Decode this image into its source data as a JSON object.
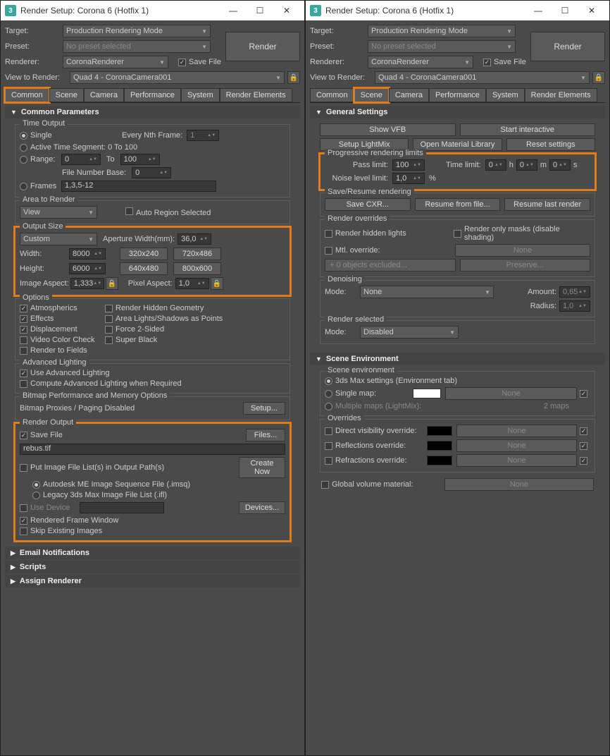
{
  "left": {
    "title": "Render Setup: Corona 6 (Hotfix 1)",
    "target_lbl": "Target:",
    "target": "Production Rendering Mode",
    "preset_lbl": "Preset:",
    "preset": "No preset selected",
    "renderer_lbl": "Renderer:",
    "renderer": "CoronaRenderer",
    "savefile": "Save File",
    "render_btn": "Render",
    "view_lbl": "View to Render:",
    "view": "Quad 4 - CoronaCamera001",
    "tabs": [
      "Common",
      "Scene",
      "Camera",
      "Performance",
      "System",
      "Render Elements"
    ],
    "rollup": "Common Parameters",
    "time": {
      "hdr": "Time Output",
      "single": "Single",
      "every": "Every Nth Frame:",
      "every_v": "1",
      "active": "Active Time Segment:",
      "active_v": "0 To 100",
      "range": "Range:",
      "r1": "0",
      "to": "To",
      "r2": "100",
      "fnb": "File Number Base:",
      "fnb_v": "0",
      "frames": "Frames",
      "frames_v": "1,3,5-12"
    },
    "area": {
      "hdr": "Area to Render",
      "view": "View",
      "auto": "Auto Region Selected"
    },
    "out": {
      "hdr": "Output Size",
      "custom": "Custom",
      "ap": "Aperture Width(mm):",
      "ap_v": "36,0",
      "w": "Width:",
      "w_v": "8000",
      "h": "Height:",
      "h_v": "6000",
      "p1": "320x240",
      "p2": "720x486",
      "p3": "640x480",
      "p4": "800x600",
      "ia": "Image Aspect:",
      "ia_v": "1,333",
      "pa": "Pixel Aspect:",
      "pa_v": "1,0"
    },
    "opt": {
      "hdr": "Options",
      "atm": "Atmospherics",
      "rhg": "Render Hidden Geometry",
      "eff": "Effects",
      "als": "Area Lights/Shadows as Points",
      "disp": "Displacement",
      "f2": "Force 2-Sided",
      "vcc": "Video Color Check",
      "sb": "Super Black",
      "rtf": "Render to Fields"
    },
    "adv": {
      "hdr": "Advanced Lighting",
      "use": "Use Advanced Lighting",
      "comp": "Compute Advanced Lighting when Required"
    },
    "bmp": {
      "hdr": "Bitmap Performance and Memory Options",
      "txt": "Bitmap Proxies / Paging Disabled",
      "setup": "Setup..."
    },
    "ro": {
      "hdr": "Render Output",
      "sf": "Save File",
      "files": "Files...",
      "file": "rebus.tif",
      "put": "Put Image File List(s) in Output Path(s)",
      "create": "Create Now",
      "ame": "Autodesk ME Image Sequence File (.imsq)",
      "leg": "Legacy 3ds Max Image File List (.ifl)",
      "ud": "Use Device",
      "dev": "Devices...",
      "rfw": "Rendered Frame Window",
      "skip": "Skip Existing Images"
    },
    "more": [
      "Email Notifications",
      "Scripts",
      "Assign Renderer"
    ]
  },
  "right": {
    "title": "Render Setup: Corona 6 (Hotfix 1)",
    "target_lbl": "Target:",
    "target": "Production Rendering Mode",
    "preset_lbl": "Preset:",
    "preset": "No preset selected",
    "renderer_lbl": "Renderer:",
    "renderer": "CoronaRenderer",
    "savefile": "Save File",
    "render_btn": "Render",
    "view_lbl": "View to Render:",
    "view": "Quad 4 - CoronaCamera001",
    "tabs": [
      "Common",
      "Scene",
      "Camera",
      "Performance",
      "System",
      "Render Elements"
    ],
    "rollup": "General Settings",
    "row1": {
      "vfb": "Show VFB",
      "start": "Start interactive",
      "slm": "Setup LightMix",
      "oml": "Open Material Library",
      "rs": "Reset settings"
    },
    "prog": {
      "hdr": "Progressive rendering limits",
      "pl": "Pass limit:",
      "pl_v": "100",
      "tl": "Time limit:",
      "tl_h": "0",
      "h": "h",
      "tl_m": "0",
      "m": "m",
      "tl_s": "0",
      "s": "s",
      "nl": "Noise level limit:",
      "nl_v": "1,0",
      "pct": "%"
    },
    "sr": {
      "hdr": "Save/Resume rendering",
      "save": "Save CXR...",
      "resume": "Resume from file...",
      "last": "Resume last render"
    },
    "ovr": {
      "hdr": "Render overrides",
      "rhl": "Render hidden lights",
      "rom": "Render only masks (disable shading)",
      "mtl": "Mtl. override:",
      "none": "None",
      "exc": "0 objects excluded...",
      "pres": "Preserve..."
    },
    "den": {
      "hdr": "Denoising",
      "mode": "Mode:",
      "none": "None",
      "amt": "Amount:",
      "amt_v": "0,65",
      "rad": "Radius:",
      "rad_v": "1,0"
    },
    "rs2": {
      "hdr": "Render selected",
      "mode": "Mode:",
      "dis": "Disabled"
    },
    "env": {
      "hdr": "Scene Environment",
      "se": "Scene environment",
      "max": "3ds Max settings (Environment tab)",
      "sm": "Single map:",
      "none": "None",
      "mm": "Multiple maps (LightMix):",
      "maps": "2 maps",
      "ov": "Overrides",
      "dvo": "Direct visibility override:",
      "ref": "Reflections override:",
      "refr": "Refractions override:",
      "gvm": "Global volume material:"
    }
  }
}
